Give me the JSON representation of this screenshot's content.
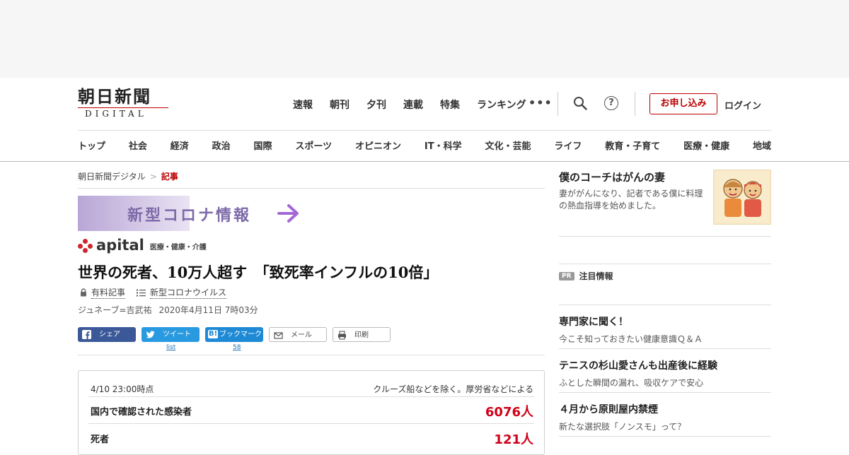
{
  "site": {
    "logo_jp": "朝日新聞",
    "logo_en": "DIGITAL"
  },
  "top_nav": [
    "速報",
    "朝刊",
    "夕刊",
    "連載",
    "特集",
    "ランキング"
  ],
  "more_label": "•••",
  "help_glyph": "?",
  "signup_label": "お申し込み",
  "login_label": "ログイン",
  "category_nav": [
    "トップ",
    "社会",
    "経済",
    "政治",
    "国際",
    "スポーツ",
    "オピニオン",
    "IT・科学",
    "文化・芸能",
    "ライフ",
    "教育・子育て",
    "医療・健康",
    "地域"
  ],
  "breadcrumb": {
    "home": "朝日新聞デジタル",
    "separator": ">",
    "current": "記事"
  },
  "corona_banner": "新型コロナ情報",
  "apital": {
    "brand": "apital",
    "subtitle": "医療・健康・介護"
  },
  "article": {
    "headline": "世界の死者、10万人超す　「致死率インフルの10倍」",
    "tag_paid": "有料記事",
    "tag_series": "新型コロナウイルス",
    "byline": "ジュネーブ=吉武祐",
    "date": "2020年4月11日 7時03分"
  },
  "share": {
    "facebook": "シェア",
    "twitter": "ツイート",
    "hatena_mark": "B!",
    "hatena": "ブックマーク",
    "mail": "メール",
    "print": "印刷",
    "twitter_count": "list",
    "hatena_count": "58"
  },
  "stats": {
    "as_of": "4/10 23:00時点",
    "note": "クルーズ船などを除く。厚労省などによる",
    "rows": [
      {
        "label": "国内で確認された感染者",
        "value": "6076人"
      },
      {
        "label": "死者",
        "value": "121人"
      }
    ]
  },
  "sidebar": {
    "feature_title": "僕のコーチはがんの妻",
    "feature_desc": "妻ががんになり、記者である僕に料理の熱血指導を始めました。",
    "pr_badge": "PR",
    "pr_title": "注目情報",
    "items": [
      {
        "title": "専門家に聞く！",
        "sub": "今こそ知っておきたい健康意識Ｑ＆Ａ"
      },
      {
        "title": "テニスの杉山愛さんも出産後に経験",
        "sub": "ふとした瞬間の漏れ、吸収ケアで安心"
      },
      {
        "title": "４月から原則屋内禁煙",
        "sub": "新たな選択肢「ノンスモ」って？"
      }
    ]
  },
  "colors": {
    "accent_red": "#b00000",
    "figure_red": "#d0021b",
    "facebook": "#3b5998",
    "twitter": "#2a9ae0",
    "hatena": "#1e8ad6"
  }
}
